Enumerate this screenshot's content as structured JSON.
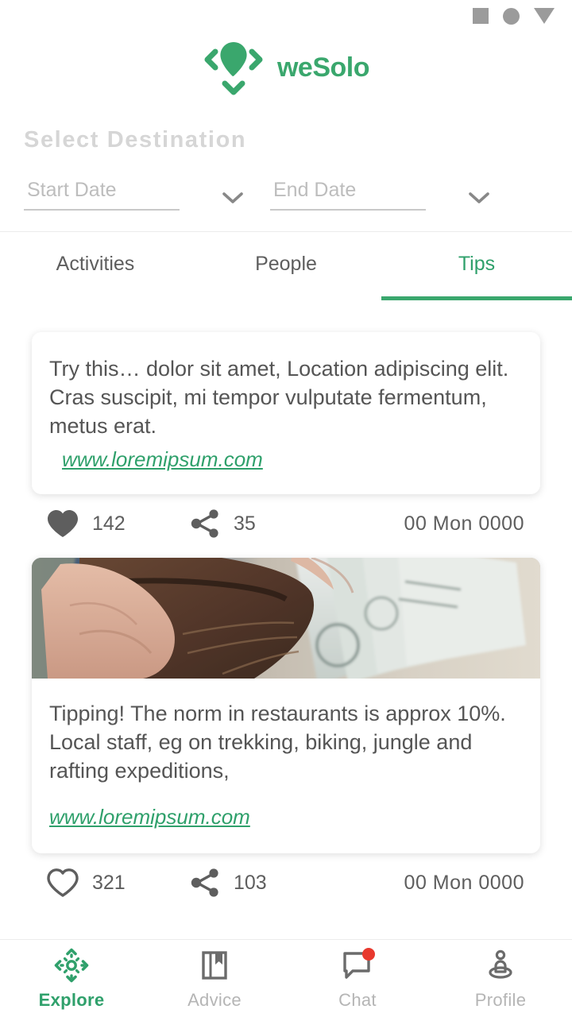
{
  "statusbar": {
    "icons": [
      "square-icon",
      "circle-icon",
      "triangle-down-icon"
    ]
  },
  "header": {
    "logo_icon": "location-pin-explore-icon",
    "brand_name": "weSolo",
    "brand_color": "#3aa76d"
  },
  "destination": {
    "title": "Select Destination",
    "start_date": {
      "label": "Start Date",
      "value": "",
      "chevron_icon": "chevron-down-icon"
    },
    "end_date": {
      "label": "End Date",
      "value": "",
      "chevron_icon": "chevron-down-icon"
    }
  },
  "tabs": [
    {
      "label": "Activities",
      "active": false
    },
    {
      "label": "People",
      "active": false
    },
    {
      "label": "Tips",
      "active": true
    }
  ],
  "feed": [
    {
      "text": "Try this… dolor sit amet, Location adipiscing elit. Cras suscipit, mi tempor vulputate fermentum, metus erat.",
      "link": "www.loremipsum.com",
      "likes": "142",
      "shares": "35",
      "date": "00 Mon 0000",
      "liked": true,
      "has_image": false
    },
    {
      "text": "Tipping! The norm in restaurants is approx 10%. Local staff, eg on trekking, biking, jungle and rafting expeditions,",
      "link": "www.loremipsum.com",
      "likes": "321",
      "shares": "103",
      "date": "00 Mon 0000",
      "liked": false,
      "has_image": true,
      "image_alt": "hand-holding-wallet-with-dollar-bills"
    }
  ],
  "bottomnav": [
    {
      "label": "Explore",
      "icon": "explore-compass-icon",
      "active": true,
      "badge": false
    },
    {
      "label": "Advice",
      "icon": "book-bookmark-icon",
      "active": false,
      "badge": false
    },
    {
      "label": "Chat",
      "icon": "chat-bubble-icon",
      "active": false,
      "badge": true,
      "badge_color": "#e8392e"
    },
    {
      "label": "Profile",
      "icon": "person-pin-icon",
      "active": false,
      "badge": false
    }
  ]
}
